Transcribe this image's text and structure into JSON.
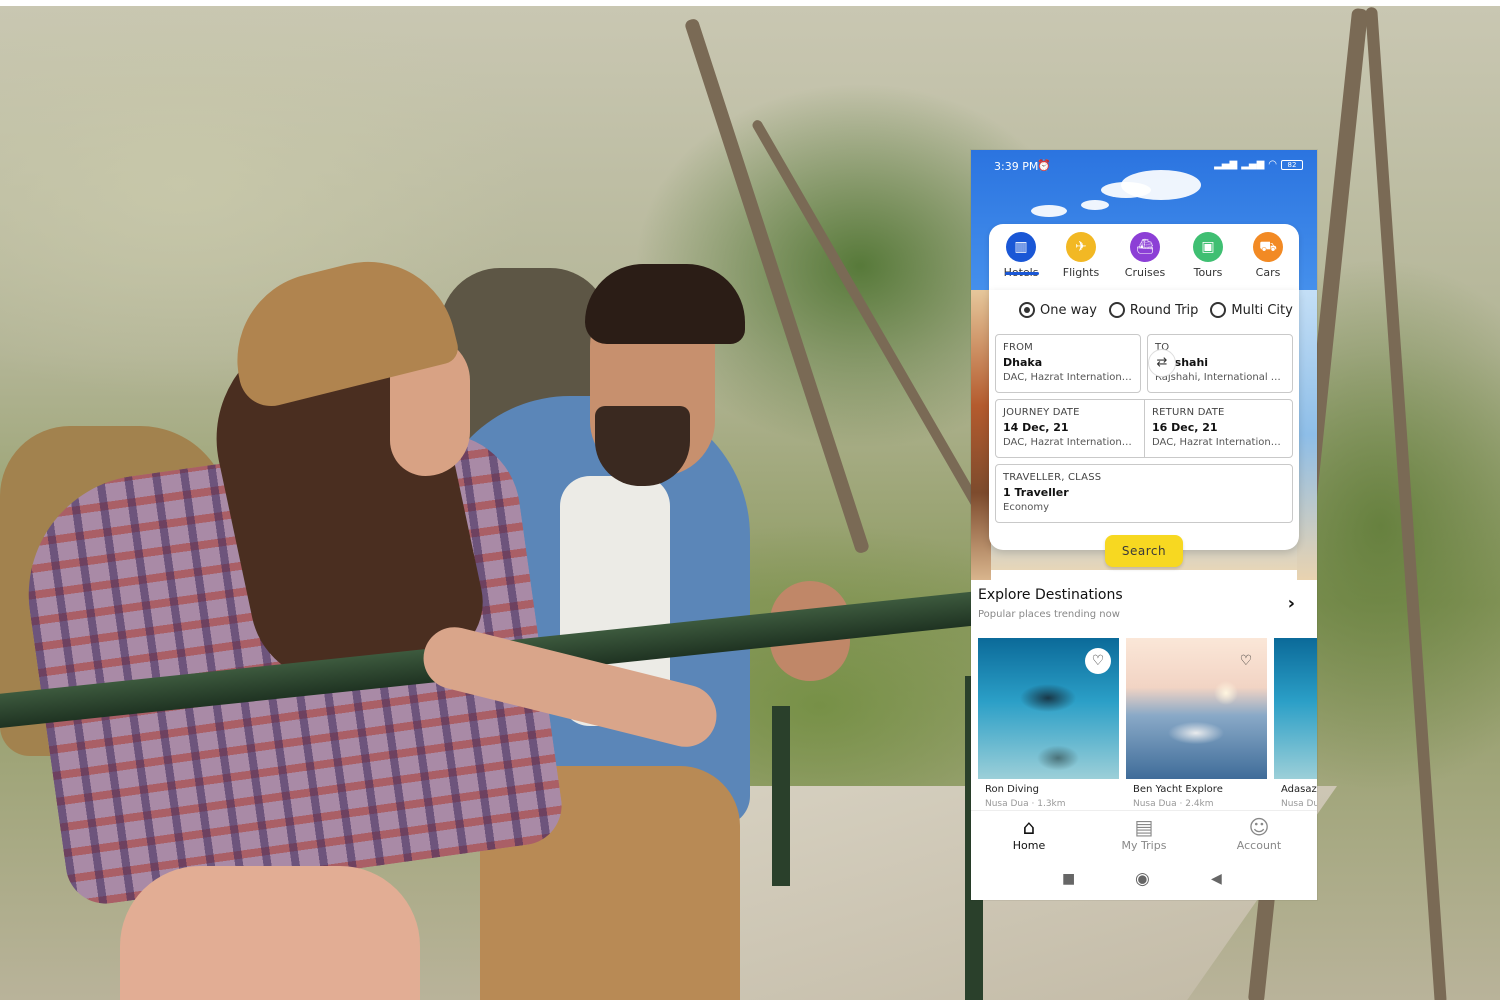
{
  "status": {
    "time": "3:39 PM",
    "battery": "82"
  },
  "tabs": [
    {
      "label": "Hotels",
      "icon": "hotel-icon",
      "color": "#1a57d6"
    },
    {
      "label": "Flights",
      "icon": "plane-icon",
      "color": "#f2b824"
    },
    {
      "label": "Cruises",
      "icon": "cruise-icon",
      "color": "#8c3fd6"
    },
    {
      "label": "Tours",
      "icon": "luggage-icon",
      "color": "#3fbf72"
    },
    {
      "label": "Cars",
      "icon": "car-icon",
      "color": "#f28a24"
    }
  ],
  "trip_types": [
    "One way",
    "Round Trip",
    "Multi City"
  ],
  "selected_trip_type": "One way",
  "from": {
    "label": "FROM",
    "city": "Dhaka",
    "airport": "DAC, Hazrat International Airport"
  },
  "to": {
    "label": "TO",
    "city": "Rajshahi",
    "airport": "Rajshahi, International Airport"
  },
  "journey": {
    "label": "JOURNEY DATE",
    "date": "14 Dec, 21",
    "sub": "DAC, Hazrat International Airport"
  },
  "return": {
    "label": "RETURN DATE",
    "date": "16 Dec, 21",
    "sub": "DAC, Hazrat International Airport"
  },
  "traveller": {
    "label": "TRAVELLER, CLASS",
    "value": "1 Traveller",
    "class": "Economy"
  },
  "search_label": "Search",
  "explore": {
    "title": "Explore Destinations",
    "subtitle": "Popular places trending  now",
    "cards": [
      {
        "name": "Ron Diving",
        "meta": "Nusa Dua · 1.3km"
      },
      {
        "name": "Ben Yacht Explore",
        "meta": "Nusa Dua · 2.4km"
      },
      {
        "name": "Adasaz",
        "meta": "Nusa Dua"
      }
    ]
  },
  "nav": [
    {
      "label": "Home",
      "icon": "home-icon"
    },
    {
      "label": "My Trips",
      "icon": "clipboard-icon"
    },
    {
      "label": "Account",
      "icon": "user-icon"
    }
  ],
  "colors": {
    "accent": "#1a57d6",
    "search_button": "#f7d821"
  }
}
